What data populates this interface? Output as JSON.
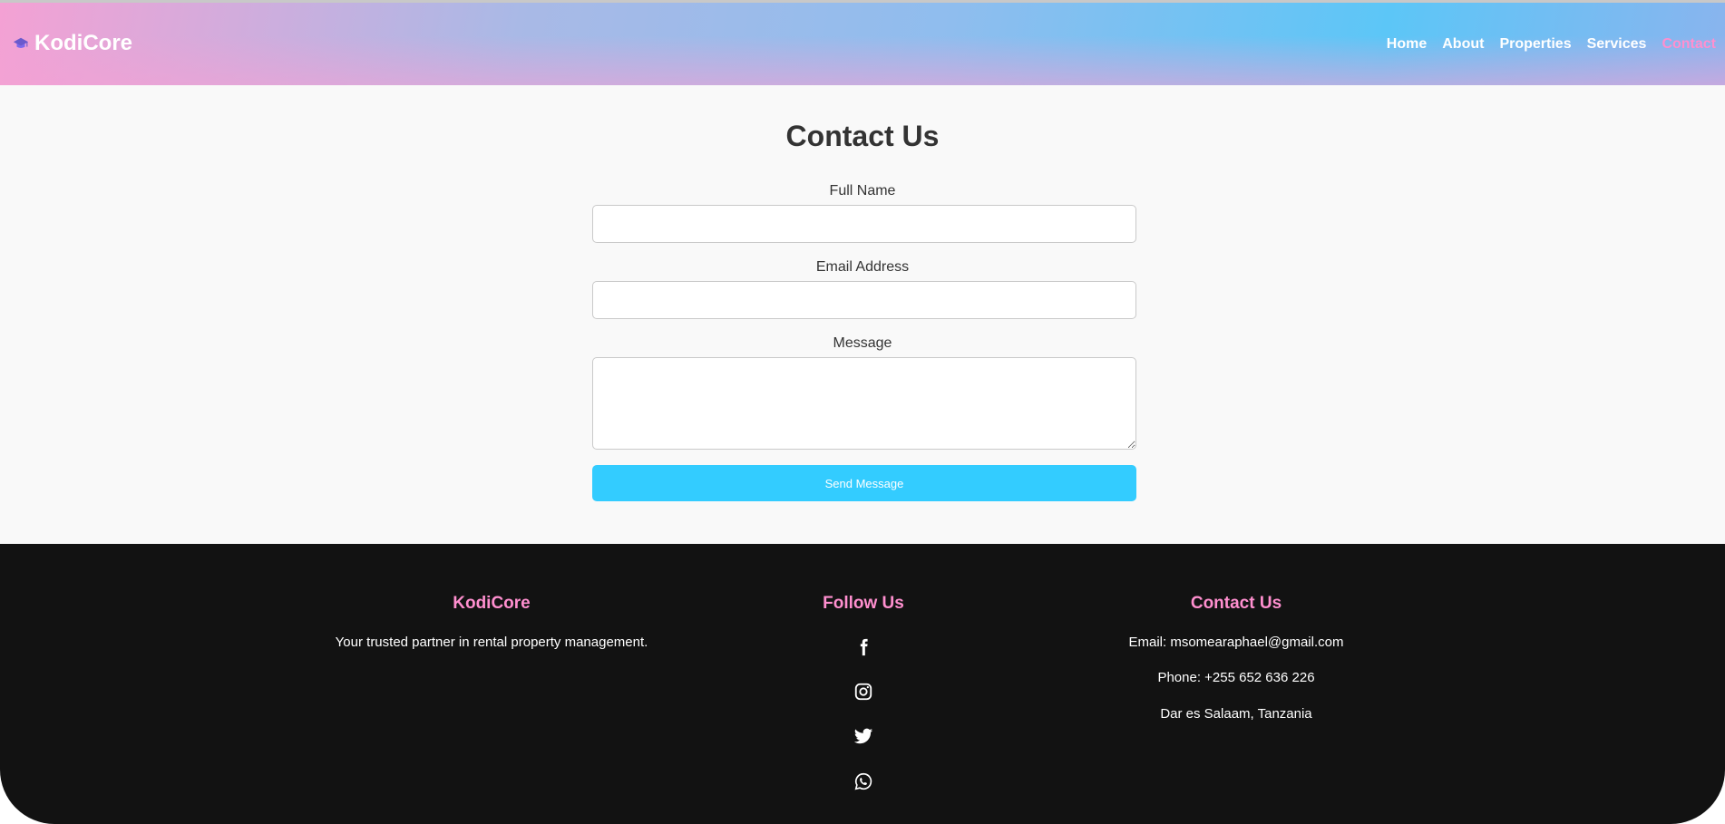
{
  "header": {
    "brand": "KodiCore",
    "brand_icon": "graduation-cap-icon",
    "nav": [
      "Home",
      "About",
      "Properties",
      "Services",
      "Contact"
    ],
    "active_nav": "Contact",
    "active_color": "#ff8fcf"
  },
  "form": {
    "title": "Contact Us",
    "name_label": "Full Name",
    "name_value": "",
    "email_label": "Email Address",
    "email_value": "",
    "message_label": "Message",
    "message_value": "",
    "submit_label": "Send Message",
    "submit_color": "#33ccff"
  },
  "footer": {
    "about_title": "KodiCore",
    "about_text": "Your trusted partner in rental property management.",
    "follow_title": "Follow Us",
    "social_icons": [
      "facebook-icon",
      "instagram-icon",
      "twitter-icon",
      "whatsapp-icon"
    ],
    "contact_title": "Contact Us",
    "email": "Email: msomearaphael@gmail.com",
    "phone": "Phone: +255 652 636 226",
    "location": "Dar es Salaam, Tanzania",
    "heading_color": "#ff8fcf"
  }
}
